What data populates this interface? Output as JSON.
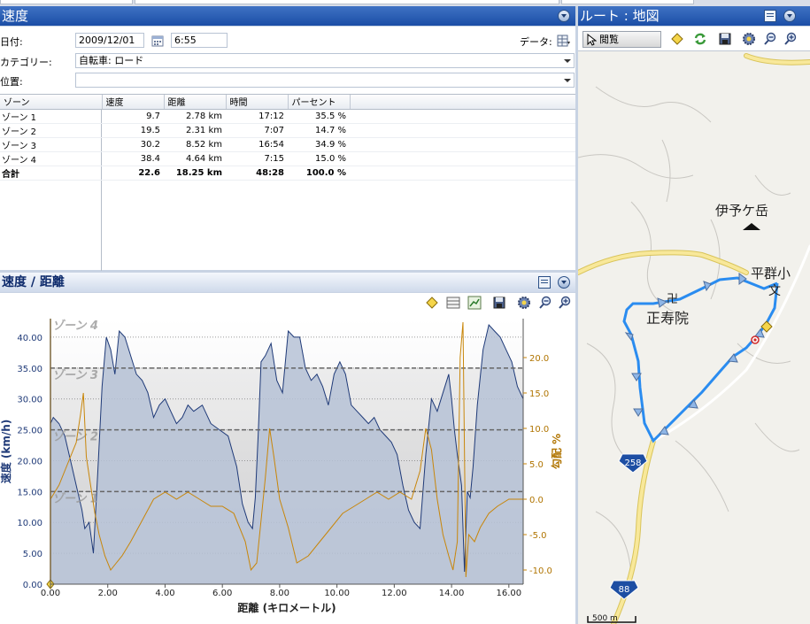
{
  "speed_panel": {
    "title": "速度",
    "date_label": "日付:",
    "date_value": "2009/12/01",
    "time_value": "6:55",
    "data_label": "データ:",
    "category_label": "カテゴリー:",
    "category_value": "自転車: ロード",
    "location_label": "位置:",
    "location_value": ""
  },
  "zones_table": {
    "columns": [
      "ゾーン",
      "速度",
      "距離",
      "時間",
      "パーセント"
    ],
    "rows": [
      [
        "ゾーン 1",
        "9.7",
        "2.78 km",
        "17:12",
        "35.5 %"
      ],
      [
        "ゾーン 2",
        "19.5",
        "2.31 km",
        "7:07",
        "14.7 %"
      ],
      [
        "ゾーン 3",
        "30.2",
        "8.52 km",
        "16:54",
        "34.9 %"
      ],
      [
        "ゾーン 4",
        "38.4",
        "4.64 km",
        "7:15",
        "15.0 %"
      ]
    ],
    "total": [
      "合計",
      "22.6",
      "18.25 km",
      "48:28",
      "100.0 %"
    ]
  },
  "chart_panel": {
    "title": "速度 / 距離"
  },
  "map_panel": {
    "title": "ルート : 地図",
    "browse_label": "閲覧",
    "labels": {
      "mountain": "伊予ケ岳",
      "school": "平群小",
      "school_symbol": "文",
      "temple_symbol": "卍",
      "temple": "正寿院",
      "road1": "258",
      "road2": "88",
      "scale": "500 m"
    }
  },
  "colors": {
    "title_bar": "#1b4ea6",
    "speed_fill": "#b6c2d6",
    "speed_line": "#1f3a78",
    "grade_line": "#c8860a",
    "route": "#2a8cf0"
  },
  "chart_data": {
    "type": "area",
    "xlabel": "距離 (キロメートル)",
    "ylabel_left": "速度 (km/h)",
    "ylabel_right": "勾配 %",
    "xlim": [
      0,
      16.5
    ],
    "ylim_left": [
      0,
      43
    ],
    "ylim_right": [
      -12,
      25.5
    ],
    "x_ticks": [
      "0.00",
      "2.00",
      "4.00",
      "6.00",
      "8.00",
      "10.00",
      "12.00",
      "14.00",
      "16.00"
    ],
    "y_ticks_left": [
      "0.00",
      "5.00",
      "10.00",
      "15.00",
      "20.00",
      "25.00",
      "30.00",
      "35.00",
      "40.00"
    ],
    "y_ticks_right": [
      "-10.0",
      "-5.0",
      "0.0",
      "5.0",
      "10.0",
      "15.0",
      "20.0"
    ],
    "zones": [
      {
        "name": "ゾーン 1",
        "value": 15
      },
      {
        "name": "ゾーン 2",
        "value": 25
      },
      {
        "name": "ゾーン 3",
        "value": 35
      },
      {
        "name": "ゾーン 4",
        "value": 45
      }
    ],
    "series": [
      {
        "name": "速度",
        "axis": "left",
        "x": [
          0,
          0.1,
          0.3,
          0.5,
          0.7,
          0.9,
          1.1,
          1.2,
          1.35,
          1.5,
          1.65,
          1.8,
          1.95,
          2.1,
          2.25,
          2.4,
          2.6,
          2.8,
          3.0,
          3.2,
          3.4,
          3.6,
          3.8,
          4.0,
          4.2,
          4.4,
          4.6,
          4.8,
          5.0,
          5.3,
          5.6,
          5.9,
          6.2,
          6.5,
          6.7,
          6.9,
          7.05,
          7.15,
          7.25,
          7.35,
          7.5,
          7.7,
          7.9,
          8.1,
          8.3,
          8.5,
          8.7,
          8.9,
          9.1,
          9.3,
          9.5,
          9.7,
          9.9,
          10.1,
          10.3,
          10.5,
          10.7,
          10.9,
          11.1,
          11.3,
          11.5,
          11.7,
          11.9,
          12.1,
          12.3,
          12.5,
          12.7,
          12.9,
          13.1,
          13.3,
          13.5,
          13.7,
          13.9,
          14.0,
          14.1,
          14.2,
          14.35,
          14.45,
          14.55,
          14.65,
          14.75,
          14.9,
          15.1,
          15.3,
          15.5,
          15.7,
          15.9,
          16.1,
          16.3,
          16.5
        ],
        "y": [
          26,
          27,
          26,
          24,
          20,
          16,
          12,
          9,
          10,
          5,
          18,
          32,
          40,
          38,
          34,
          41,
          40,
          37,
          34,
          33,
          31,
          27,
          29,
          30,
          28,
          26,
          27,
          29,
          28,
          29,
          26,
          25,
          24,
          19,
          13,
          10,
          9,
          14,
          24,
          36,
          37,
          39,
          33,
          31,
          41,
          40,
          40,
          35,
          33,
          34,
          32,
          29,
          34,
          36,
          34,
          29,
          28,
          27,
          26,
          27,
          25,
          24,
          23,
          21,
          16,
          12,
          10,
          9,
          21,
          30,
          28,
          31,
          34,
          30,
          25,
          21,
          16,
          2,
          15,
          14,
          19,
          29,
          38,
          42,
          41,
          40,
          38,
          36,
          32,
          30
        ]
      },
      {
        "name": "勾配",
        "axis": "right",
        "x": [
          0,
          0.3,
          0.6,
          0.9,
          1.05,
          1.15,
          1.25,
          1.4,
          1.55,
          1.7,
          1.9,
          2.1,
          2.3,
          2.5,
          2.8,
          3.2,
          3.6,
          4.0,
          4.4,
          4.8,
          5.2,
          5.6,
          6.0,
          6.4,
          6.8,
          7.0,
          7.2,
          7.35,
          7.5,
          7.65,
          7.8,
          8.0,
          8.3,
          8.6,
          9.0,
          9.4,
          9.8,
          10.2,
          10.6,
          11.0,
          11.4,
          11.8,
          12.2,
          12.6,
          12.9,
          13.1,
          13.3,
          13.5,
          13.7,
          13.9,
          14.05,
          14.2,
          14.3,
          14.4,
          14.5,
          14.6,
          14.8,
          15.0,
          15.3,
          15.6,
          16.0,
          16.4,
          16.5
        ],
        "y": [
          0,
          2,
          5,
          8,
          12,
          15,
          6,
          2,
          -2,
          -5,
          -8,
          -10,
          -9,
          -8,
          -6,
          -3,
          0,
          1,
          0,
          1,
          0,
          -1,
          -1,
          -2,
          -6,
          -10,
          -9,
          -3,
          3,
          10,
          6,
          0,
          -4,
          -9,
          -8,
          -6,
          -4,
          -2,
          -1,
          0,
          1,
          0,
          1,
          0,
          4,
          10,
          7,
          0,
          -5,
          -8,
          -10,
          -6,
          20,
          25,
          -11,
          -5,
          -6,
          -4,
          -2,
          -1,
          0,
          0,
          0
        ]
      }
    ]
  }
}
